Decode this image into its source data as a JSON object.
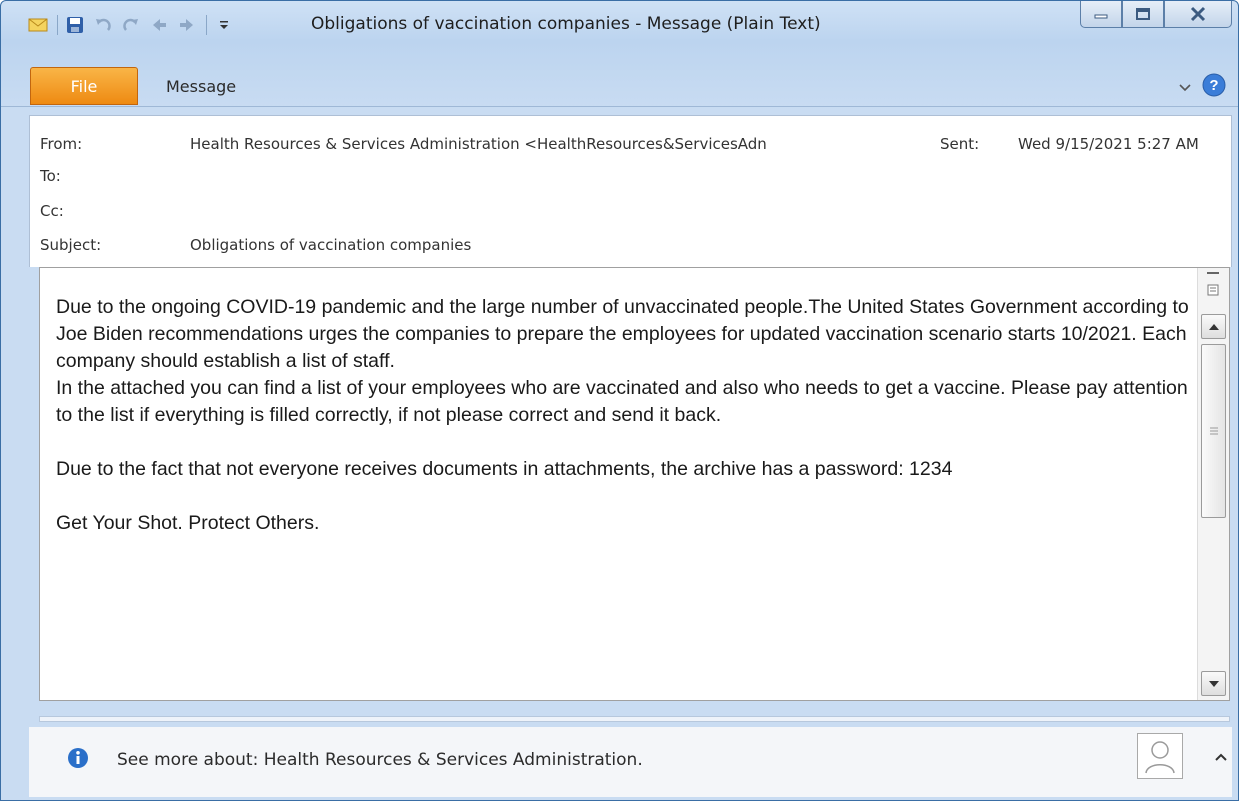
{
  "window": {
    "title": "Obligations of vaccination companies  -  Message (Plain Text)",
    "quick_access": [
      "envelope-icon",
      "save-icon",
      "undo-icon",
      "redo-icon",
      "previous-item-icon",
      "next-item-icon",
      "customize-toolbar-icon"
    ]
  },
  "ribbon": {
    "tabs": [
      {
        "label": "File",
        "active": true
      },
      {
        "label": "Message",
        "active": false
      }
    ]
  },
  "header": {
    "from_label": "From:",
    "from_value": "Health Resources & Services Administration <HealthResources&ServicesAdn",
    "sent_label": "Sent:",
    "sent_value": "Wed 9/15/2021 5:27 AM",
    "to_label": "To:",
    "cc_label": "Cc:",
    "subject_label": "Subject:",
    "subject_value": "Obligations of vaccination companies"
  },
  "body": {
    "paragraphs": [
      "Due to the ongoing COVID-19 pandemic and the large number of unvaccinated people.The United States Government according to Joe Biden recommendations urges the companies to prepare the employees for updated vaccination scenario starts 10/2021. Each company should establish a list of staff.",
      "In the attached you can find a list of your employees who are vaccinated and also who needs to get a vaccine. Please pay attention to the list if everything is filled correctly, if not please correct and send it back.",
      "Due to the fact that not everyone receives documents in attachments, the archive has a password: 1234",
      "Get Your Shot. Protect Others."
    ]
  },
  "people_pane": {
    "text": "See more about: Health Resources & Services Administration."
  },
  "colors": {
    "file_tab": "#ee8a12",
    "window_frame": "#bcd4ef",
    "info_icon": "#2a6fc9"
  }
}
